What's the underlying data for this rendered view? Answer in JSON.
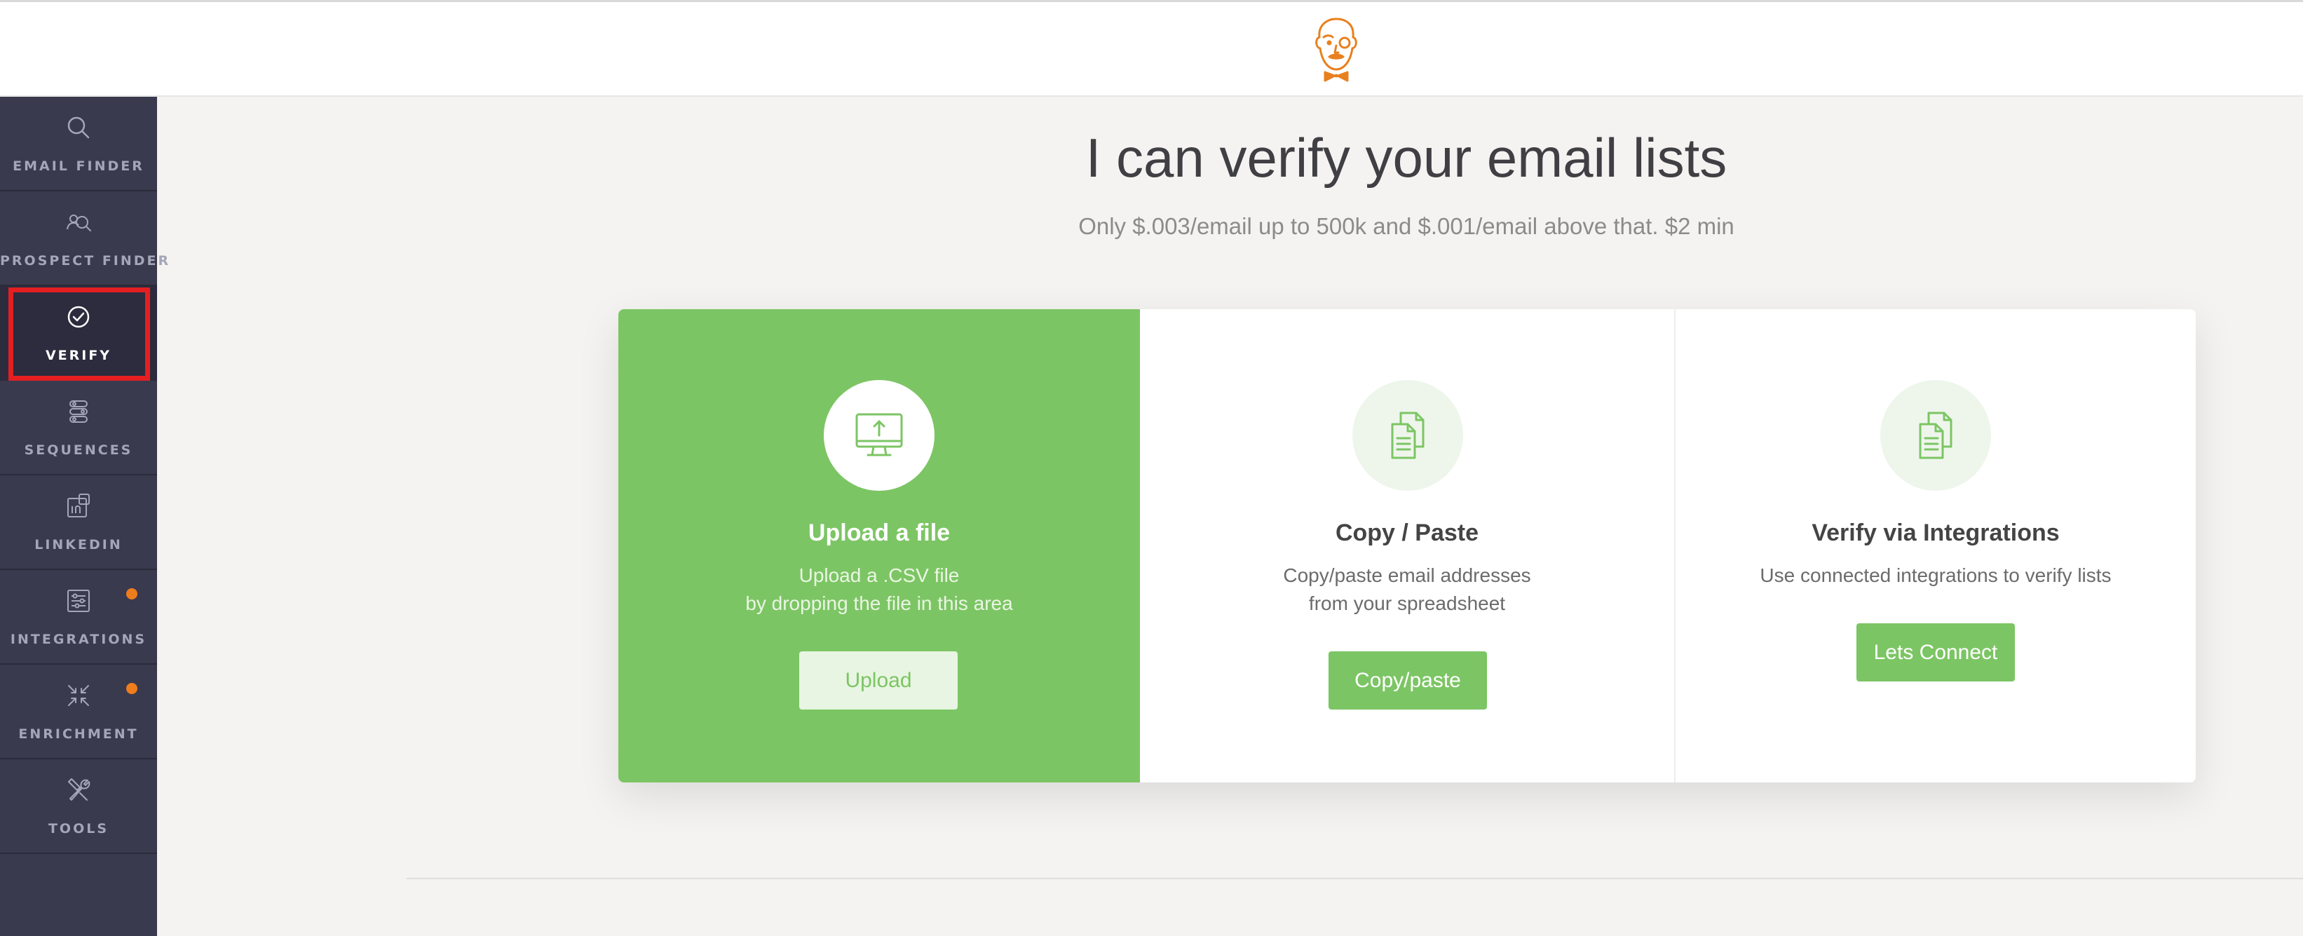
{
  "header": {
    "logo_icon": "mascot-logo"
  },
  "sidebar": {
    "items": [
      {
        "label": "EMAIL FINDER",
        "icon": "search-icon",
        "active": false
      },
      {
        "label": "PROSPECT FINDER",
        "icon": "prospect-search-icon",
        "active": false
      },
      {
        "label": "VERIFY",
        "icon": "check-circle-icon",
        "active": true
      },
      {
        "label": "SEQUENCES",
        "icon": "sequences-icon",
        "active": false
      },
      {
        "label": "LINKEDIN",
        "icon": "linkedin-icon",
        "active": false
      },
      {
        "label": "INTEGRATIONS",
        "icon": "integrations-icon",
        "active": false,
        "badge": true
      },
      {
        "label": "ENRICHMENT",
        "icon": "enrichment-icon",
        "active": false,
        "badge": true
      },
      {
        "label": "TOOLS",
        "icon": "tools-icon",
        "active": false
      }
    ]
  },
  "main": {
    "title": "I can verify your email lists",
    "subtitle": "Only $.003/email up to 500k and $.001/email above that. $2 min",
    "cards": [
      {
        "title": "Upload a file",
        "desc_line1": "Upload a .CSV file",
        "desc_line2": "by dropping the file in this area",
        "button": "Upload",
        "icon": "monitor-upload-icon"
      },
      {
        "title": "Copy / Paste",
        "desc_line1": "Copy/paste email addresses",
        "desc_line2": "from your spreadsheet",
        "button": "Copy/paste",
        "icon": "documents-icon"
      },
      {
        "title": "Verify via Integrations",
        "desc_line1": "Use connected integrations to verify lists",
        "button": "Lets Connect",
        "icon": "documents-icon"
      }
    ]
  },
  "colors": {
    "accent_green": "#7cc564",
    "sidebar_bg": "#3a3a4f",
    "highlight_red": "#e41f21",
    "badge_orange": "#ef7d1c",
    "logo_orange": "#e8801f"
  }
}
